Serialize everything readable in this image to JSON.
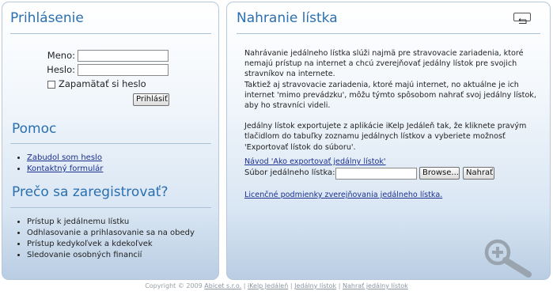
{
  "login": {
    "title": "Prihlásenie",
    "name_label": "Meno:",
    "name_value": "",
    "password_label": "Heslo:",
    "password_value": "",
    "remember_label": "Zapamätať si heslo",
    "remember_checked": false,
    "submit_label": "Prihlásiť"
  },
  "help": {
    "title": "Pomoc",
    "links": [
      "Zabudol som heslo",
      "Kontaktný formulár"
    ]
  },
  "register": {
    "title": "Prečo sa zaregistrovať?",
    "items": [
      "Prístup k jedálnemu lístku",
      "Odhlasovanie a prihlasovanie sa na obedy",
      "Prístup kedykoľvek a kdekoľvek",
      "Sledovanie osobných financií"
    ]
  },
  "upload": {
    "title": "Nahranie lístka",
    "para1": "Nahrávanie jedálneho lístka slúži najmä pre stravovacie zariadenia, ktoré nemajú prístup na internet a chcú zverejňovať jedálny lístok pre svojich stravníkov na internete.",
    "para2": "Taktiež aj stravovacie zariadenia, ktoré majú internet, no aktuálne je ich internet 'mimo prevádzku', môžu týmto spôsobom nahrať svoj jedálny lístok, aby ho stravníci videli.",
    "para3": "Jedálny lístok exportujete z aplikácie iKelp Jedáleň tak, že kliknete pravým tlačidlom do tabuľky zoznamu jedálnych lístkov a vyberiete možnosť 'Exportovať lístok do súboru'.",
    "export_link": "Návod 'Ako exportovať jedálny lístok'",
    "file_label": "Súbor jedálneho lístka:",
    "file_value": "",
    "browse_label": "Browse...",
    "upload_label": "Nahrať",
    "license_link": "Licenčné podmienky zverejňovania jedálneho lístka."
  },
  "footer": {
    "copyright": "Copyright © 2009",
    "company": "Abicet s.r.o.",
    "sep": "|",
    "links": [
      "iKelp Jedáleň",
      "Jedálny lístok",
      "Nahrať jedálny lístok"
    ]
  },
  "icons": {
    "back": "back-arrow-icon",
    "zoom": "zoom-in-icon"
  },
  "colors": {
    "heading": "#2a6fb0",
    "link": "#1a2f8f",
    "panel_border": "#b5c7d9",
    "panel_bottom": "#b9cde3"
  }
}
